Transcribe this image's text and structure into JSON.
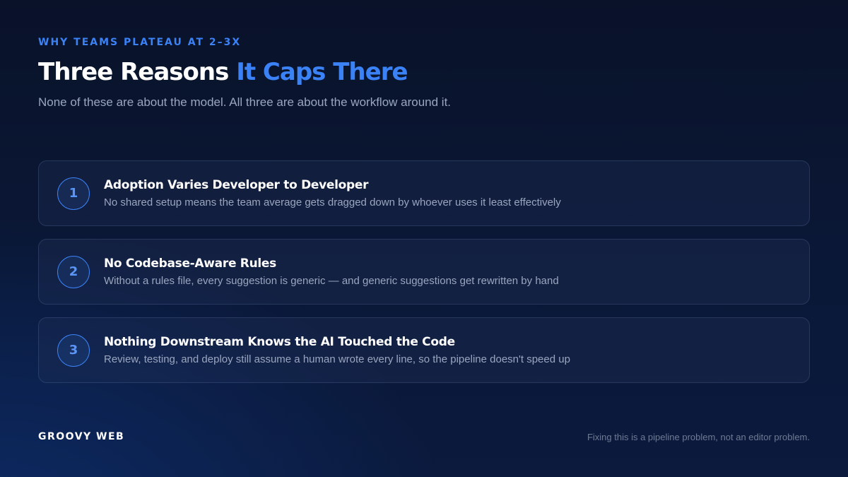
{
  "header": {
    "eyebrow": "WHY TEAMS PLATEAU AT 2–3X",
    "title_main": "Three Reasons ",
    "title_accent": "It Caps There",
    "subtitle": "None of these are about the model. All three are about the workflow around it."
  },
  "reasons": [
    {
      "number": "1",
      "title": "Adoption Varies Developer to Developer",
      "description": "No shared setup means the team average gets dragged down by whoever uses it least effectively"
    },
    {
      "number": "2",
      "title": "No Codebase-Aware Rules",
      "description": "Without a rules file, every suggestion is generic — and generic suggestions get rewritten by hand"
    },
    {
      "number": "3",
      "title": "Nothing Downstream Knows the AI Touched the Code",
      "description": "Review, testing, and deploy still assume a human wrote every line, so the pipeline doesn't speed up"
    }
  ],
  "footer": {
    "brand": "GROOVY WEB",
    "note": "Fixing this is a pipeline problem, not an editor problem."
  },
  "colors": {
    "accent": "#3b82f6",
    "background": "#0a1838",
    "muted_text": "#9aa6bf"
  }
}
